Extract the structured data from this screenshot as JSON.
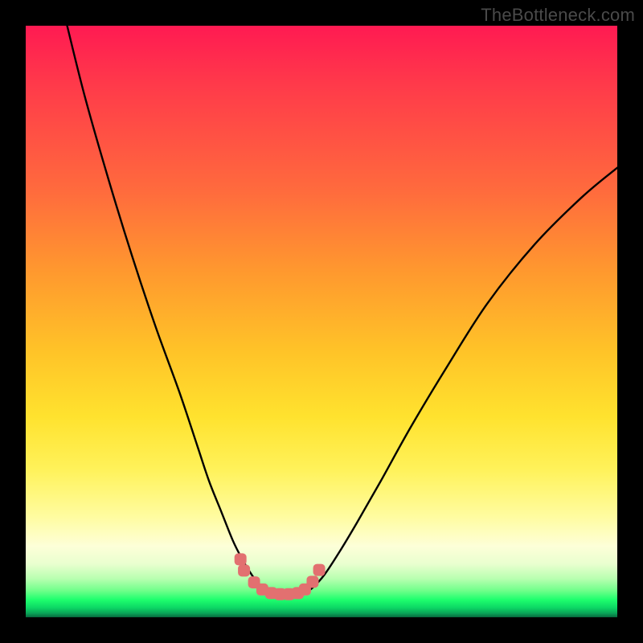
{
  "watermark": {
    "text": "TheBottleneck.com"
  },
  "colors": {
    "frame": "#000000",
    "curve": "#000000",
    "tickMarker": "#e27070",
    "gradientTop": "#ff1a52",
    "gradientBottom": "#07683e"
  },
  "chart_data": {
    "type": "line",
    "title": "",
    "xlabel": "",
    "ylabel": "",
    "xlim": [
      0,
      100
    ],
    "ylim": [
      0,
      100
    ],
    "grid": false,
    "legend": false,
    "series": [
      {
        "name": "left-branch",
        "x": [
          7,
          10,
          14,
          18,
          22,
          26,
          29,
          31,
          33,
          35,
          36.5,
          38,
          39.2,
          40.3,
          41
        ],
        "y": [
          100,
          88,
          74,
          61,
          49,
          38,
          29,
          23,
          18,
          13,
          10,
          7.5,
          5.8,
          4.6,
          4.0
        ]
      },
      {
        "name": "right-branch",
        "x": [
          47,
          48.5,
          50.5,
          53,
          56,
          60,
          65,
          71,
          78,
          86,
          94,
          100
        ],
        "y": [
          4.0,
          5.0,
          7.2,
          11,
          16,
          23,
          32,
          42,
          53,
          63,
          71,
          76
        ]
      },
      {
        "name": "trough-markers",
        "x": [
          36.3,
          36.9,
          38.6,
          40.0,
          41.5,
          43.0,
          44.5,
          46.0,
          47.2,
          48.5,
          49.6
        ],
        "y": [
          9.8,
          7.9,
          5.9,
          4.7,
          4.1,
          3.9,
          3.9,
          4.1,
          4.7,
          6.0,
          8.0
        ]
      }
    ],
    "annotations": []
  }
}
